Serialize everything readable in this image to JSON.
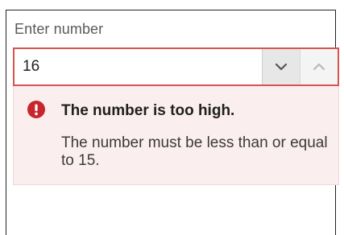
{
  "field": {
    "label": "Enter number",
    "value": "16"
  },
  "stepper": {
    "down_icon": "chevron-down-icon",
    "up_icon": "chevron-up-icon"
  },
  "error": {
    "icon": "exclamation-circle-icon",
    "title": "The number is too high.",
    "description": "The number must be less than or equal to 15."
  },
  "colors": {
    "error_border": "#d9534f",
    "error_background": "#fbeeee",
    "error_icon": "#c9252c",
    "stepper_down_bg": "#e7e7e7",
    "stepper_up_bg": "#f4f4f4"
  }
}
